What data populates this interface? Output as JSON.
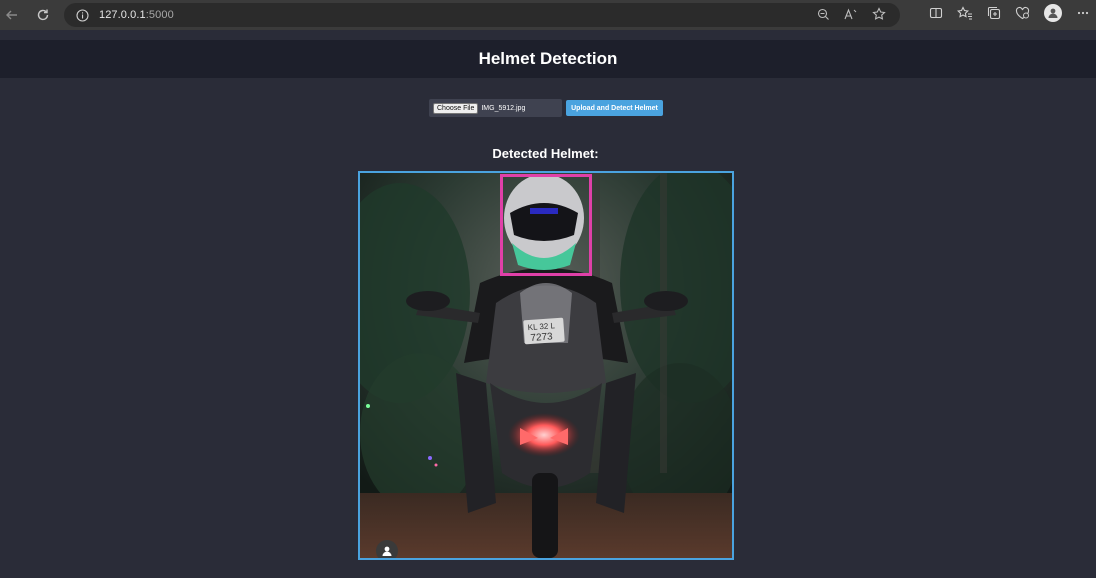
{
  "browser": {
    "url_host": "127.0.0.1",
    "url_port": ":5000"
  },
  "header": {
    "title": "Helmet Detection"
  },
  "upload": {
    "choose_label": "Choose File",
    "file_name": "IMG_5912.jpg",
    "submit_label": "Upload and Detect Helmet"
  },
  "result": {
    "title": "Detected Helmet:",
    "plate_line1": "KL 32 L",
    "plate_line2": "7273"
  },
  "colors": {
    "accent": "#4aa3df",
    "bbox": "#e040a8",
    "header_bg": "#1d1f2b",
    "page_bg": "#2a2c38"
  },
  "icons": [
    "back-arrow-icon",
    "reload-icon",
    "info-icon",
    "zoom-icon",
    "read-aloud-icon",
    "favorite-star-icon",
    "split-screen-icon",
    "favorites-icon",
    "collections-icon",
    "performance-icon",
    "profile-icon",
    "more-icon",
    "avatar-icon"
  ]
}
